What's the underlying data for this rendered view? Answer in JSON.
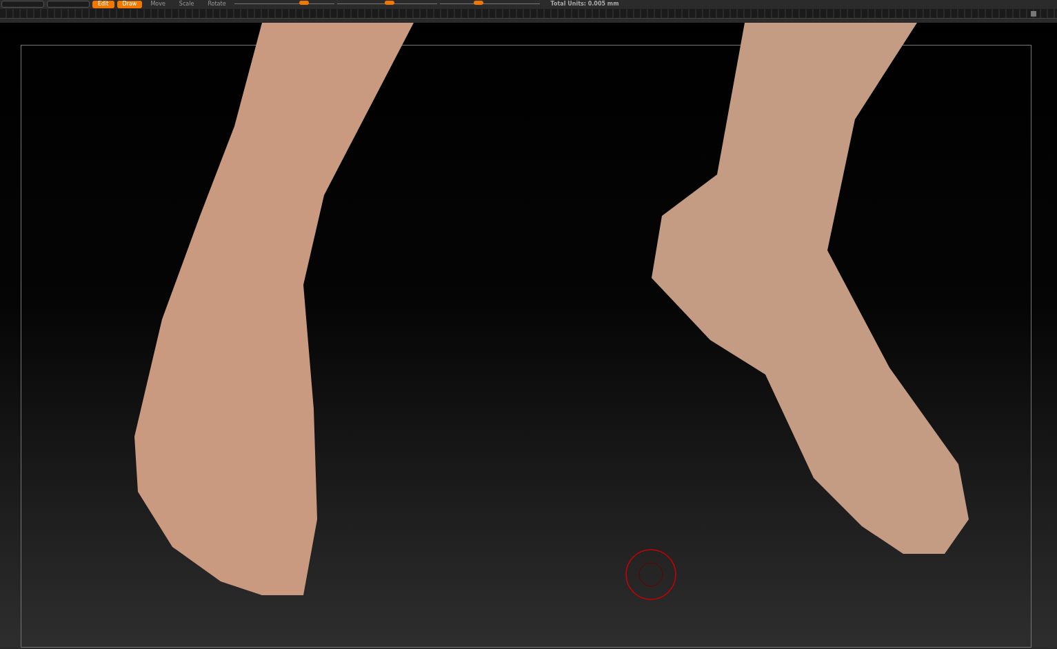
{
  "toolbar": {
    "buttons": [
      {
        "label": "Edit",
        "selected": true
      },
      {
        "label": "Draw",
        "selected": true
      },
      {
        "label": "Move",
        "selected": false
      },
      {
        "label": "Scale",
        "selected": false
      },
      {
        "label": "Rotate",
        "selected": false
      }
    ],
    "sliders": [
      {
        "level": 0.7
      },
      {
        "level": 0.53
      },
      {
        "level": 0.39
      }
    ],
    "readout": "Total Units: 0.005 mm"
  }
}
